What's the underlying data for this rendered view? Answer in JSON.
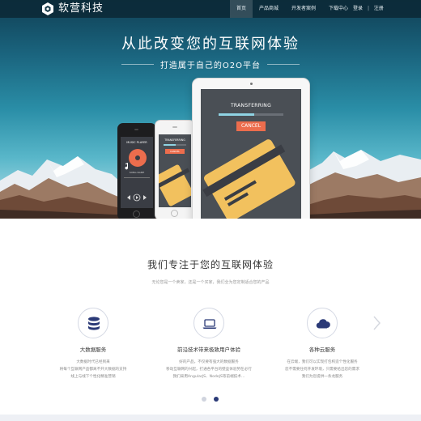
{
  "brand": {
    "name": "软营科技",
    "logo_icon": "hexagon-logo-icon"
  },
  "nav": {
    "items": [
      {
        "label": "首页",
        "active": true
      },
      {
        "label": "产品商城",
        "active": false
      },
      {
        "label": "开发者案例",
        "active": false
      },
      {
        "label": "下载中心",
        "active": false
      }
    ],
    "auth": {
      "login": "登录",
      "separator": "|",
      "register": "注册"
    }
  },
  "hero": {
    "title": "从此改变您的互联网体验",
    "subtitle": "打造属于自己的O2O平台"
  },
  "devices": {
    "phone_dark": {
      "screen_title": "MUSIC PLAYER",
      "song_label": "SONG NAME"
    },
    "phone_white": {
      "screen_title": "TRANSFERRING",
      "button": "CANCEL"
    },
    "tablet": {
      "screen_title": "TRANSFERRING",
      "button": "CANCEL",
      "progress": 0.55
    }
  },
  "section": {
    "title": "我们专注于您的互联网体验",
    "subtitle": "无论您是一个卖家，还是一个买家，我们全为您定制适合您的产品"
  },
  "features": [
    {
      "icon": "database-icon",
      "title": "大数据服务",
      "lines": [
        "大数据时代已经到来",
        "将每个互联网产品都离不开大数据的支持",
        "线上与线下个性化精准营销"
      ]
    },
    {
      "icon": "laptop-icon",
      "title": "前沿技术带来极致用户体验",
      "lines": [
        "好的产品，不仅要有强大的数据服务",
        "移动互联网的兴起，打通各平台的壁垒体验势在必行",
        "我们采用AngularJS、NodeJS等前端技术…"
      ]
    },
    {
      "icon": "cloud-icon",
      "title": "各种云服务",
      "lines": [
        "在云端，我们可以实现打包构造个性化服务",
        "您不需要任何开发环境，只需要给出您的需求",
        "我们为您提供一条龙服务"
      ]
    }
  ],
  "carousel": {
    "slide_count": 2,
    "active_index": 1
  },
  "colors": {
    "nav_bg": "#0c2a38",
    "accent_orange": "#ec6d4d",
    "card_yellow": "#f2c15e",
    "icon_blue": "#2b3a77",
    "dot_active": "#2b3a77",
    "dot_inactive": "#d0d4de"
  }
}
